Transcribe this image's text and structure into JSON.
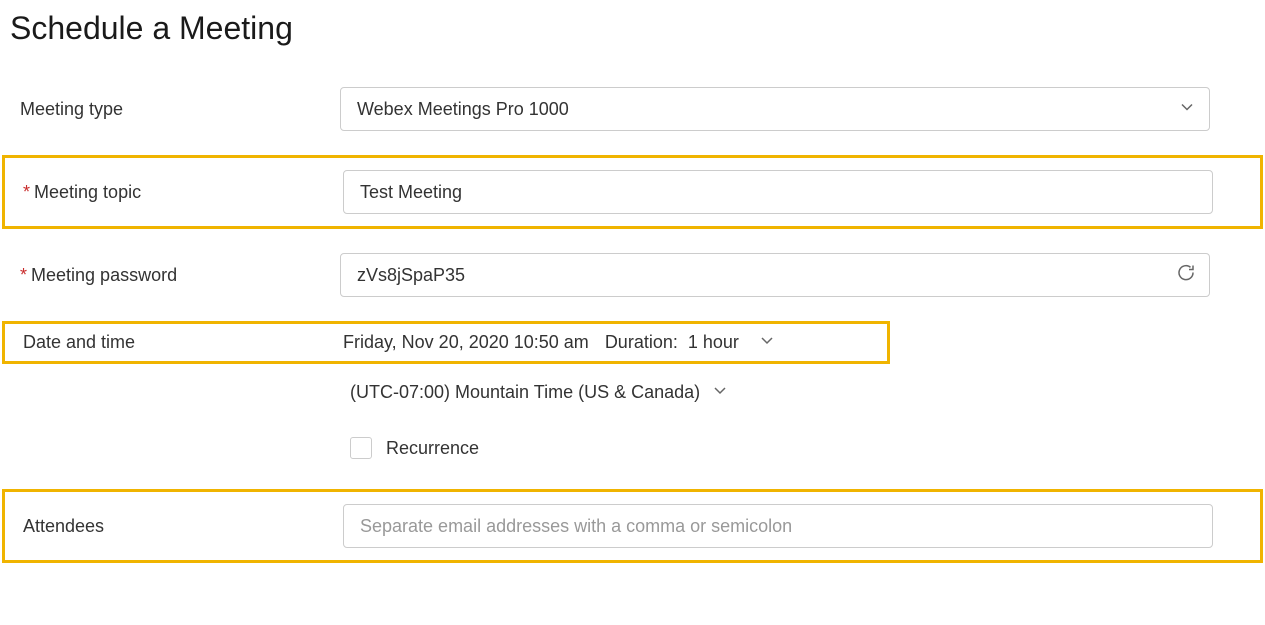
{
  "title": "Schedule a Meeting",
  "labels": {
    "meetingType": "Meeting type",
    "meetingTopic": "Meeting topic",
    "meetingPassword": "Meeting password",
    "dateTime": "Date and time",
    "attendees": "Attendees",
    "recurrence": "Recurrence"
  },
  "values": {
    "meetingType": "Webex Meetings Pro 1000",
    "meetingTopic": "Test Meeting",
    "meetingPassword": "zVs8jSpaP35",
    "dateTime": "Friday, Nov 20, 2020 10:50 am",
    "durationLabel": "Duration:",
    "durationValue": "1 hour",
    "timezone": "(UTC-07:00) Mountain Time (US & Canada)"
  },
  "placeholders": {
    "attendees": "Separate email addresses with a comma or semicolon"
  }
}
